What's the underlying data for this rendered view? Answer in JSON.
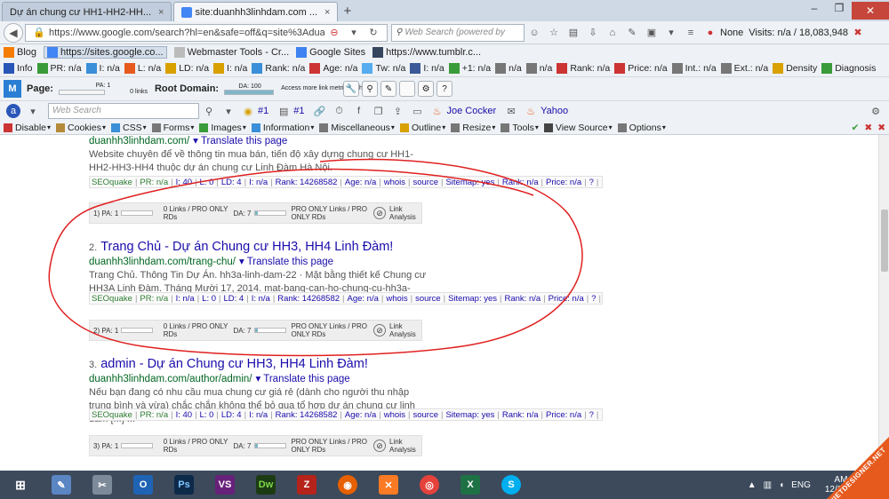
{
  "tabs": [
    {
      "label": "Dự án chung cư HH1-HH2-HH...",
      "close": "×"
    },
    {
      "label": "site:duanhh3linhdam.com ...",
      "close": "×"
    }
  ],
  "new_tab": "+",
  "nav": {
    "url": "https://www.google.com/search?hl=en&safe=off&q=site%3Aduanhh3linhdam.com&btn",
    "search_placeholder": "Web Search (powered by",
    "none_label": "None",
    "visits": "Visits: n/a / 18,083,948"
  },
  "bookmarks": [
    "Blog",
    "https://sites.google.co...",
    "Webmaster Tools - Cr...",
    "Google Sites",
    "https://www.tumblr.c..."
  ],
  "seo_toolbar": [
    "Info",
    "PR: n/a",
    "I: n/a",
    "L: n/a",
    "LD: n/a",
    "I: n/a",
    "Rank: n/a",
    "Age: n/a",
    "Tw: n/a",
    "I: n/a",
    "+1: n/a",
    "n/a",
    "n/a",
    "Rank: n/a",
    "Price: n/a",
    "Int.: n/a",
    "Ext.: n/a",
    "Density",
    "Diagnosis"
  ],
  "moz_toolbar": {
    "page_label": "Page:",
    "pa": "PA: 1",
    "links": "0 links",
    "root_label": "Root Domain:",
    "da": "DA: 100",
    "note": "Access more link metrics with PRO"
  },
  "google_toolbar": {
    "search_placeholder": "Web Search",
    "rank1": "#1",
    "rank2": "#1",
    "joe": "Joe Cocker",
    "yahoo": "Yahoo"
  },
  "dev_toolbar": [
    "Disable",
    "Cookies",
    "CSS",
    "Forms",
    "Images",
    "Information",
    "Miscellaneous",
    "Outline",
    "Resize",
    "Tools",
    "View Source",
    "Options"
  ],
  "results": [
    {
      "num": "",
      "title": "",
      "url": "duanhh3linhdam.com/",
      "translate": "Translate this page",
      "snippet": "Website chuyên để về thông tin mua bán, tiến độ xây dựng chung cư HH1-HH2-HH3-HH4 thuộc dự án chung cư Linh Đàm Hà Nội.",
      "seoquake": {
        "label": "SEOquake",
        "pr": "PR: n/a",
        "i": "I: 40",
        "l": "L: 0",
        "ld": "LD: 4",
        "i2": "I: n/a",
        "rank": "Rank: 14268582",
        "age": "Age: n/a",
        "whois": "whois",
        "source": "source",
        "sitemap": "Sitemap: yes",
        "rank2": "Rank: n/a",
        "price": "Price: n/a",
        "q": "?"
      },
      "moz": {
        "pa": "1) PA: 1",
        "links": "0 Links / PRO ONLY RDs",
        "da": "DA: 7",
        "rds": "PRO ONLY Links / PRO ONLY RDs",
        "link": "Link Analysis"
      }
    },
    {
      "num": "2.",
      "title": "Trang Chủ - Dự án Chung cư HH3, HH4 Linh Đàm!",
      "url": "duanhh3linhdam.com/trang-chu/",
      "translate": "Translate this page",
      "snippet": "Trang Chủ. Thông Tin Dự Án. hh3a-linh-dam-22 · Mặt bằng thiết kế Chung cư HH3A Linh Đàm. Tháng Mười 17, 2014. mat-bang-can-ho-chung-cu-hh3a-linh- ...",
      "seoquake": {
        "label": "SEOquake",
        "pr": "PR: n/a",
        "i": "I: n/a",
        "l": "L: 0",
        "ld": "LD: 4",
        "i2": "I: n/a",
        "rank": "Rank: 14268582",
        "age": "Age: n/a",
        "whois": "whois",
        "source": "source",
        "sitemap": "Sitemap: yes",
        "rank2": "Rank: n/a",
        "price": "Price: n/a",
        "q": "?"
      },
      "moz": {
        "pa": "2) PA: 1",
        "links": "0 Links / PRO ONLY RDs",
        "da": "DA: 7",
        "rds": "PRO ONLY Links / PRO ONLY RDs",
        "link": "Link Analysis"
      }
    },
    {
      "num": "3.",
      "title": "admin - Dự án Chung cư HH3, HH4 Linh Đàm!",
      "url": "duanhh3linhdam.com/author/admin/",
      "translate": "Translate this page",
      "snippet": "Nếu bạn đang có nhu cầu mua chung cư giá rẻ (dành cho người thu nhập trung bình và vừa) chắc chắn không thể bỏ qua tổ hợp dự án chung cư linh đàm [...] ...",
      "seoquake": {
        "label": "SEOquake",
        "pr": "PR: n/a",
        "i": "I: 40",
        "l": "L: 0",
        "ld": "LD: 4",
        "i2": "I: n/a",
        "rank": "Rank: 14268582",
        "age": "Age: n/a",
        "whois": "whois",
        "source": "source",
        "sitemap": "Sitemap: yes",
        "rank2": "Rank: n/a",
        "price": "Price: n/a",
        "q": "?"
      },
      "moz": {
        "pa": "3) PA: 1",
        "links": "0 Links / PRO ONLY RDs",
        "da": "DA: 7",
        "rds": "PRO ONLY Links / PRO ONLY RDs",
        "link": "Link Analysis"
      }
    }
  ],
  "taskbar": {
    "apps": [
      "start",
      "paint",
      "tools",
      "outlook",
      "photoshop",
      "visual-studio",
      "dreamweaver",
      "filezilla",
      "firefox",
      "xampp",
      "chrome",
      "excel",
      "skype"
    ],
    "labels": {
      "outlook": "O",
      "photoshop": "Ps",
      "vs": "VS",
      "dw": "Dw",
      "excel": "X",
      "skype": "S"
    },
    "lang": "ENG",
    "time": "AM",
    "date": "12/2014"
  },
  "watermark": "VIETDESIGNER.NET",
  "colors": {
    "link": "#1a0dab",
    "url": "#006621",
    "annotation": "#e02020"
  }
}
